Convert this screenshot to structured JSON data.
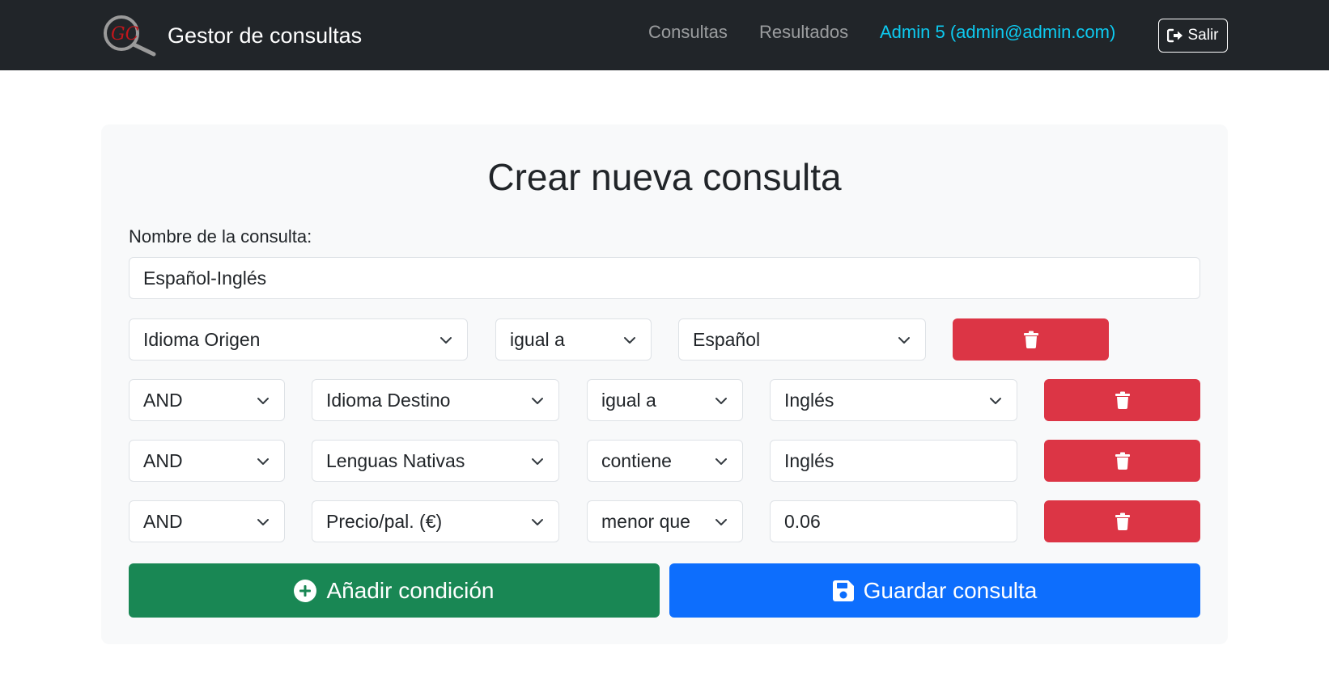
{
  "navbar": {
    "logo_text": "GC",
    "brand": "Gestor de consultas",
    "links": {
      "consultas": "Consultas",
      "resultados": "Resultados"
    },
    "user": "Admin 5  (admin@admin.com)",
    "logout_label": "Salir"
  },
  "form": {
    "title": "Crear nueva consulta",
    "name_label": "Nombre de la consulta:",
    "name_value": "Español-Inglés",
    "first_condition": {
      "field": "Idioma Origen",
      "operator": "igual a",
      "value": "Español"
    },
    "conditions": [
      {
        "connector": "AND",
        "field": "Idioma Destino",
        "operator": "igual a",
        "value": "Inglés",
        "value_is_select": true
      },
      {
        "connector": "AND",
        "field": "Lenguas Nativas",
        "operator": "contiene",
        "value": "Inglés",
        "value_is_select": false
      },
      {
        "connector": "AND",
        "field": "Precio/pal. (€)",
        "operator": "menor que",
        "value": "0.06",
        "value_is_select": false
      }
    ],
    "add_button": "Añadir condición",
    "save_button": "Guardar consulta"
  },
  "colors": {
    "navbar_bg": "#212529",
    "accent_user": "#0dcaf0",
    "danger": "#dc3545",
    "success": "#198754",
    "primary": "#0d6efd",
    "logo_red": "#c0161c"
  },
  "icons": {
    "logo": "magnifier-logo-icon",
    "logout": "sign-out-icon",
    "delete": "trash-icon",
    "add": "plus-circle-icon",
    "save": "floppy-disk-icon",
    "dropdown": "chevron-down-icon"
  }
}
